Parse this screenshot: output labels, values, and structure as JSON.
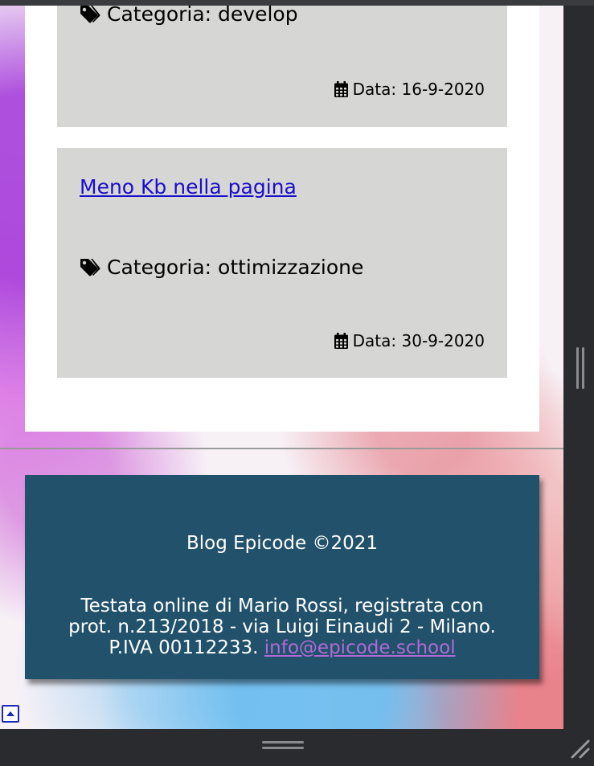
{
  "posts": [
    {
      "category_label": "Categoria: develop",
      "date_label": "Data: 16-9-2020"
    },
    {
      "title": "Meno Kb nella pagina",
      "category_label": "Categoria: ottimizzazione",
      "date_label": "Data: 30-9-2020"
    }
  ],
  "footer": {
    "title": "Blog Epicode ©2021",
    "line1": "Testata online di Mario Rossi, registrata con",
    "line2": "prot. n.213/2018 - via Luigi Einaudi 2 - Milano.",
    "line3_prefix": "P.IVA 00112233. ",
    "email": "info@epicode.school"
  },
  "icons": {
    "tag": "tag-icon",
    "calendar": "calendar-icon",
    "scroll_top": "scroll-top-icon"
  },
  "colors": {
    "card_bg": "#d6d7d5",
    "link": "#1a0dcc",
    "footer_bg": "#22526b",
    "email_link": "#b06ad6"
  }
}
